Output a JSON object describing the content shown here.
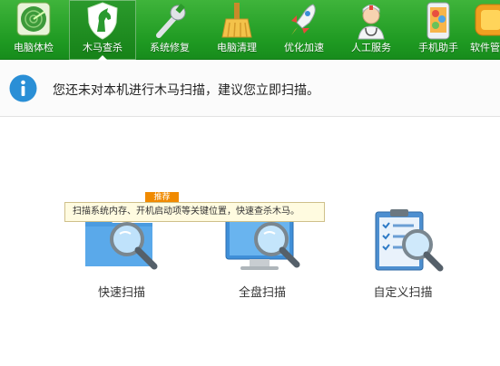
{
  "toolbar": {
    "items": [
      {
        "label": "电脑体检",
        "icon": "radar-icon"
      },
      {
        "label": "木马查杀",
        "icon": "horse-shield-icon",
        "active": true
      },
      {
        "label": "系统修复",
        "icon": "wrench-icon"
      },
      {
        "label": "电脑清理",
        "icon": "broom-icon"
      },
      {
        "label": "优化加速",
        "icon": "rocket-icon"
      },
      {
        "label": "人工服务",
        "icon": "doctor-icon"
      },
      {
        "label": "手机助手",
        "icon": "phone-icon"
      },
      {
        "label": "软件管",
        "icon": "software-icon"
      }
    ],
    "accent": "#1f9a22"
  },
  "notice": {
    "message": "您还未对本机进行木马扫描，建议您立即扫描。",
    "icon": "info-icon",
    "icon_color": "#2a8fd6"
  },
  "scan_options": [
    {
      "label": "快速扫描",
      "icon": "folder-magnifier-icon"
    },
    {
      "label": "全盘扫描",
      "icon": "monitor-magnifier-icon"
    },
    {
      "label": "自定义扫描",
      "icon": "clipboard-magnifier-icon"
    }
  ],
  "recommend_badge": "推荐",
  "tooltip": "扫描系统内存、开机启动项等关键位置，快速查杀木马。"
}
